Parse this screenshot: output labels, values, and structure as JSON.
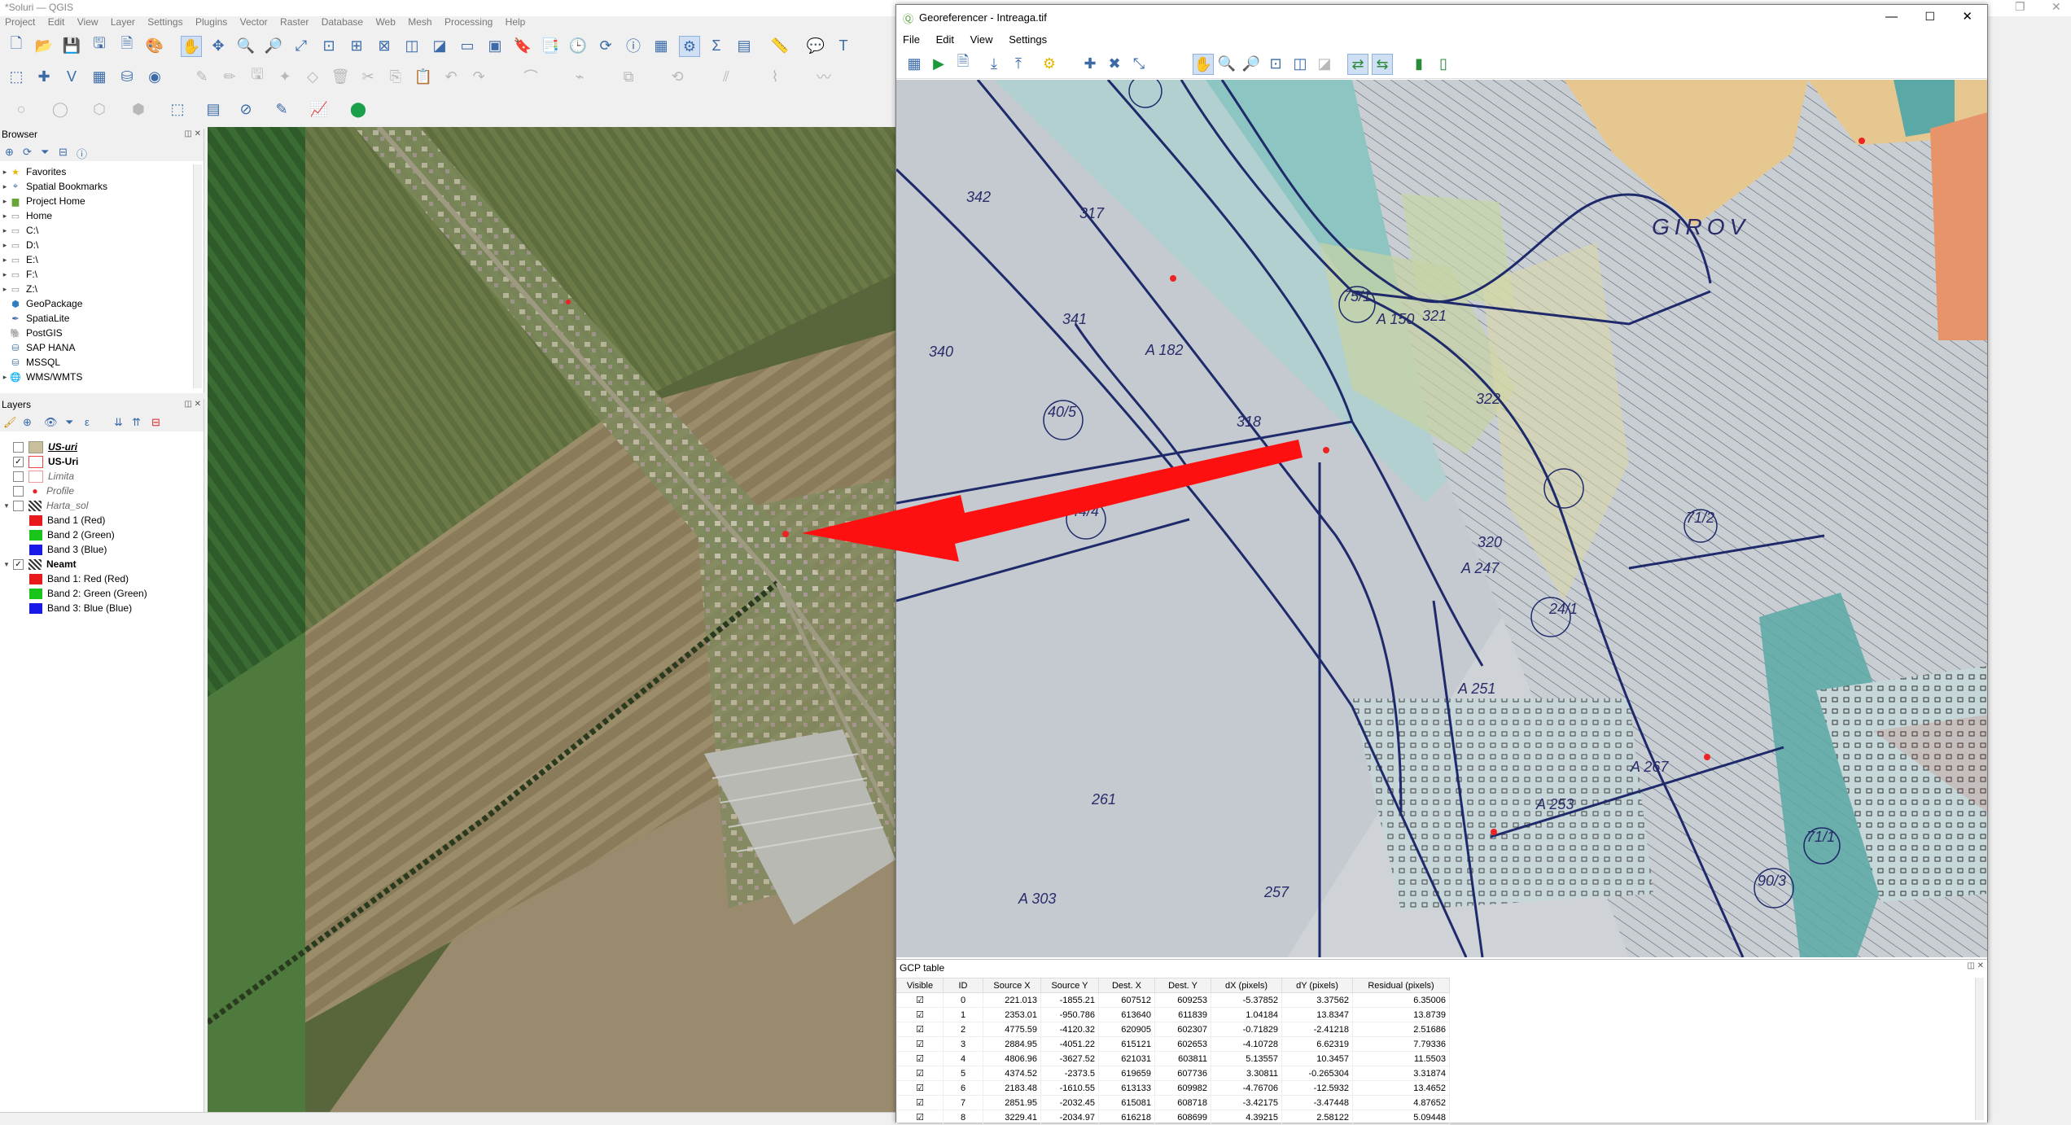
{
  "qgis": {
    "title": "*Soluri — QGIS",
    "menu": [
      "Project",
      "Edit",
      "View",
      "Layer",
      "Settings",
      "Plugins",
      "Vector",
      "Raster",
      "Database",
      "Web",
      "Mesh",
      "Processing",
      "Help"
    ]
  },
  "browser": {
    "title": "Browser",
    "items": [
      {
        "label": "Favorites",
        "icon": "star-icon"
      },
      {
        "label": "Spatial Bookmarks",
        "icon": "bookmark-icon"
      },
      {
        "label": "Project Home",
        "icon": "folder-icon"
      },
      {
        "label": "Home",
        "icon": "folder-icon"
      },
      {
        "label": "C:\\",
        "icon": "drive-icon"
      },
      {
        "label": "D:\\",
        "icon": "drive-icon"
      },
      {
        "label": "E:\\",
        "icon": "drive-icon"
      },
      {
        "label": "F:\\",
        "icon": "drive-icon"
      },
      {
        "label": "Z:\\",
        "icon": "drive-icon"
      },
      {
        "label": "GeoPackage",
        "icon": "geopackage-icon"
      },
      {
        "label": "SpatiaLite",
        "icon": "spatialite-icon"
      },
      {
        "label": "PostGIS",
        "icon": "postgis-icon"
      },
      {
        "label": "SAP HANA",
        "icon": "database-icon"
      },
      {
        "label": "MSSQL",
        "icon": "database-icon"
      },
      {
        "label": "WMS/WMTS",
        "icon": "globe-icon"
      }
    ]
  },
  "layers": {
    "title": "Layers",
    "items": [
      {
        "label": "US-uri",
        "style": "italic-bold-underline",
        "checked": false
      },
      {
        "label": "US-Uri",
        "style": "bold",
        "checked": true
      },
      {
        "label": "Limita",
        "style": "italic",
        "checked": false
      },
      {
        "label": "Profile",
        "style": "italic",
        "checked": false
      },
      {
        "label": "Harta_sol",
        "style": "italic",
        "checked": false
      },
      {
        "label": "Band 1 (Red)",
        "style": "band",
        "color": "#e8191b"
      },
      {
        "label": "Band 2 (Green)",
        "style": "band",
        "color": "#18c418"
      },
      {
        "label": "Band 3 (Blue)",
        "style": "band",
        "color": "#1a1ae6"
      },
      {
        "label": "Neamt",
        "style": "bold",
        "checked": true
      },
      {
        "label": "Band 1: Red (Red)",
        "style": "band",
        "color": "#e8191b"
      },
      {
        "label": "Band 2: Green (Green)",
        "style": "band",
        "color": "#18c418"
      },
      {
        "label": "Band 3: Blue (Blue)",
        "style": "band",
        "color": "#1a1ae6"
      }
    ]
  },
  "georef": {
    "title": "Georeferencer - Intreaga.tif",
    "menu": [
      "File",
      "Edit",
      "View",
      "Settings"
    ],
    "map_labels": [
      "GIROV",
      "342",
      "317",
      "340",
      "341",
      "321",
      "322",
      "318",
      "320",
      "261",
      "257",
      "75/1",
      "40/5",
      "44/4",
      "71/2",
      "24/1",
      "90/3",
      "71/1",
      "A 303",
      "A 247",
      "A 251",
      "A 253",
      "A 267",
      "A 182",
      "A 150"
    ]
  },
  "gcp": {
    "title": "GCP table",
    "columns": [
      "Visible",
      "ID",
      "Source X",
      "Source Y",
      "Dest. X",
      "Dest. Y",
      "dX (pixels)",
      "dY (pixels)",
      "Residual (pixels)"
    ],
    "rows": [
      [
        "0",
        "221.013",
        "-1855.21",
        "607512",
        "609253",
        "-5.37852",
        "3.37562",
        "6.35006"
      ],
      [
        "1",
        "2353.01",
        "-950.786",
        "613640",
        "611839",
        "1.04184",
        "13.8347",
        "13.8739"
      ],
      [
        "2",
        "4775.59",
        "-4120.32",
        "620905",
        "602307",
        "-0.71829",
        "-2.41218",
        "2.51686"
      ],
      [
        "3",
        "2884.95",
        "-4051.22",
        "615121",
        "602653",
        "-4.10728",
        "6.62319",
        "7.79336"
      ],
      [
        "4",
        "4806.96",
        "-3627.52",
        "621031",
        "603811",
        "5.13557",
        "10.3457",
        "11.5503"
      ],
      [
        "5",
        "4374.52",
        "-2373.5",
        "619659",
        "607736",
        "3.30811",
        "-0.265304",
        "3.31874"
      ],
      [
        "6",
        "2183.48",
        "-1610.55",
        "613133",
        "609982",
        "-4.76706",
        "-12.5932",
        "13.4652"
      ],
      [
        "7",
        "2851.95",
        "-2032.45",
        "615081",
        "608718",
        "-3.42175",
        "-3.47448",
        "4.87652"
      ],
      [
        "8",
        "3229.41",
        "-2034.97",
        "616218",
        "608699",
        "4.39215",
        "2.58122",
        "5.09448"
      ]
    ]
  },
  "colors": {
    "arrow": "#ff1010",
    "accent": "#3a6aa8"
  }
}
